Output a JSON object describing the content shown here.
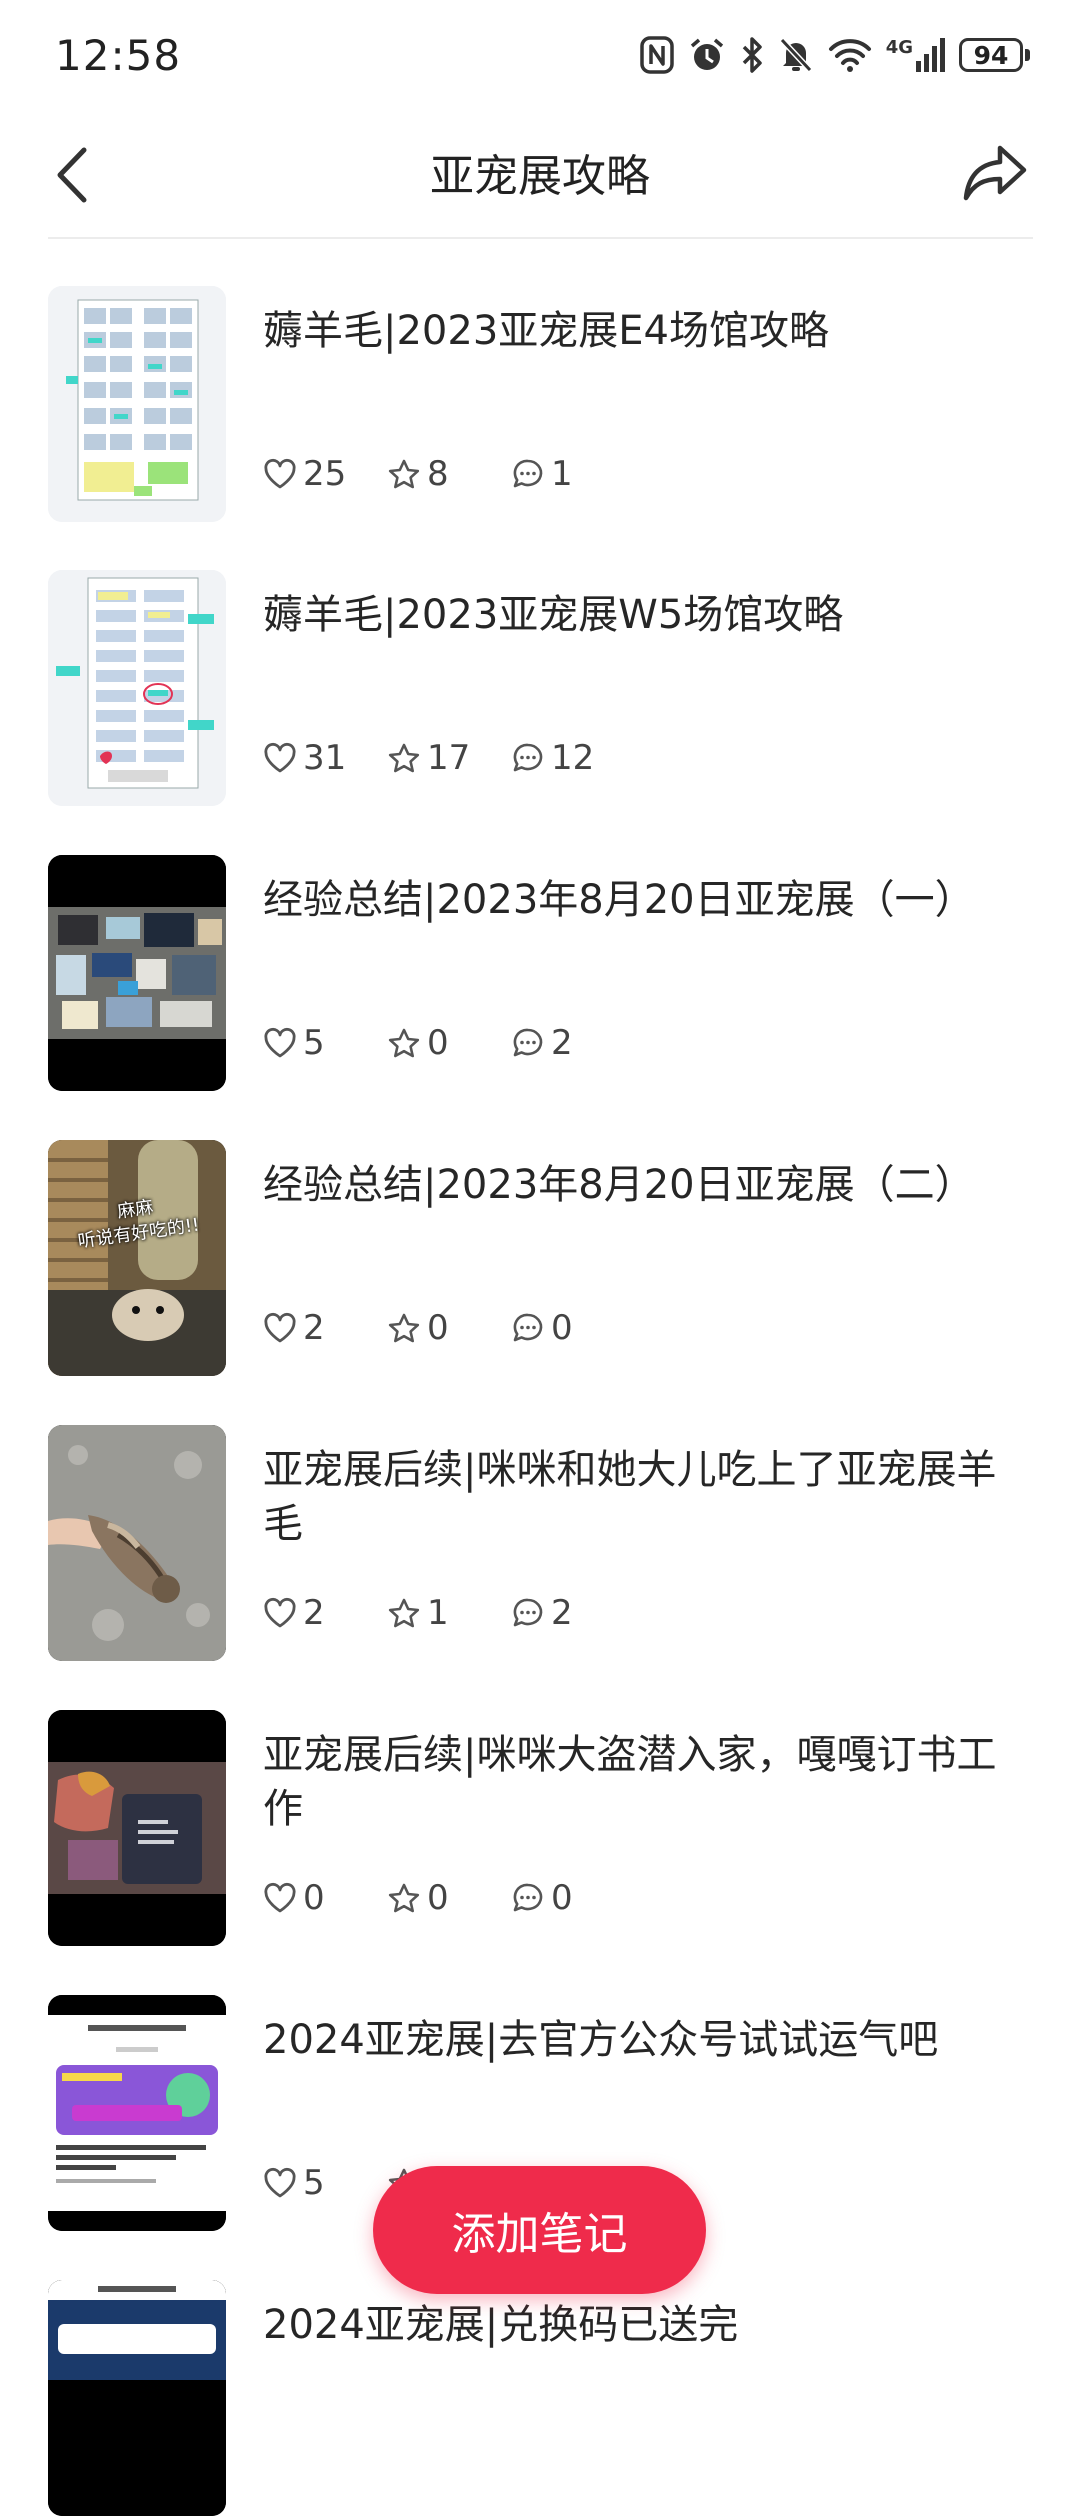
{
  "status_bar": {
    "time": "12:58",
    "network": "4G",
    "battery": "94",
    "icons": [
      "nfc-icon",
      "alarm-icon",
      "bluetooth-icon",
      "mute-icon",
      "wifi-icon",
      "signal-icon",
      "battery-icon"
    ]
  },
  "nav": {
    "title": "亚宠展攻略",
    "back_icon": "chevron-left-icon",
    "share_icon": "share-icon"
  },
  "items": [
    {
      "title": "薅羊毛|2023亚宠展E4场馆攻略",
      "likes": "25",
      "stars": "8",
      "comments": "1",
      "thumb": "venue-map-e4"
    },
    {
      "title": "薅羊毛|2023亚宠展W5场馆攻略",
      "likes": "31",
      "stars": "17",
      "comments": "12",
      "thumb": "venue-map-w5"
    },
    {
      "title": "经验总结|2023年8月20日亚宠展（一）",
      "likes": "5",
      "stars": "0",
      "comments": "2",
      "thumb": "haul-photo"
    },
    {
      "title": "经验总结|2023年8月20日亚宠展（二）",
      "likes": "2",
      "stars": "0",
      "comments": "0",
      "thumb": "hamster-photo"
    },
    {
      "title": "亚宠展后续|咪咪和她大儿吃上了亚宠展羊毛",
      "likes": "2",
      "stars": "1",
      "comments": "2",
      "thumb": "cat-photo"
    },
    {
      "title": "亚宠展后续|咪咪大盗潜入家，嘎嘎订书工作",
      "likes": "0",
      "stars": "0",
      "comments": "0",
      "thumb": "bag-photo"
    },
    {
      "title": "2024亚宠展|去官方公众号试试运气吧",
      "likes": "5",
      "stars": "",
      "comments": "",
      "thumb": "screenshot-article"
    },
    {
      "title": "2024亚宠展|兑换码已送完",
      "likes": "",
      "stars": "",
      "comments": "",
      "thumb": "screenshot-app"
    }
  ],
  "thumb_text": {
    "hamster_caption_1": "麻麻",
    "hamster_caption_2": "听说有好吃的!!"
  },
  "fab": {
    "label": "添加笔记"
  },
  "colors": {
    "accent": "#ef2b4b",
    "text": "#262626",
    "divider": "#ececec"
  }
}
